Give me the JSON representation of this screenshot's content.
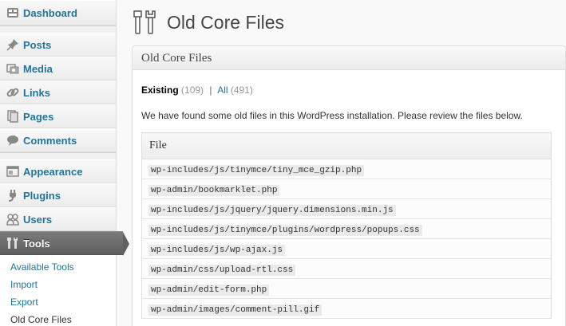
{
  "sidebar": {
    "dashboard": "Dashboard",
    "posts": "Posts",
    "media": "Media",
    "links": "Links",
    "pages": "Pages",
    "comments": "Comments",
    "appearance": "Appearance",
    "plugins": "Plugins",
    "users": "Users",
    "tools": "Tools",
    "submenu": [
      "Available Tools",
      "Import",
      "Export",
      "Old Core Files"
    ]
  },
  "page": {
    "title": "Old Core Files",
    "box_title": "Old Core Files",
    "filter": {
      "existing_label": "Existing",
      "existing_count": "(109)",
      "separator": "|",
      "all_label": "All",
      "all_count": "(491)"
    },
    "description": "We have found some old files in this WordPress installation. Please review the files below.",
    "table": {
      "header": "File",
      "rows": [
        "wp-includes/js/tinymce/tiny_mce_gzip.php",
        "wp-admin/bookmarklet.php",
        "wp-includes/js/jquery/jquery.dimensions.min.js",
        "wp-includes/js/tinymce/plugins/wordpress/popups.css",
        "wp-includes/js/wp-ajax.js",
        "wp-admin/css/upload-rtl.css",
        "wp-admin/edit-form.php",
        "wp-admin/images/comment-pill.gif"
      ]
    }
  },
  "colors": {
    "link": "#21759b",
    "active_menu": "#6d6d6d"
  }
}
